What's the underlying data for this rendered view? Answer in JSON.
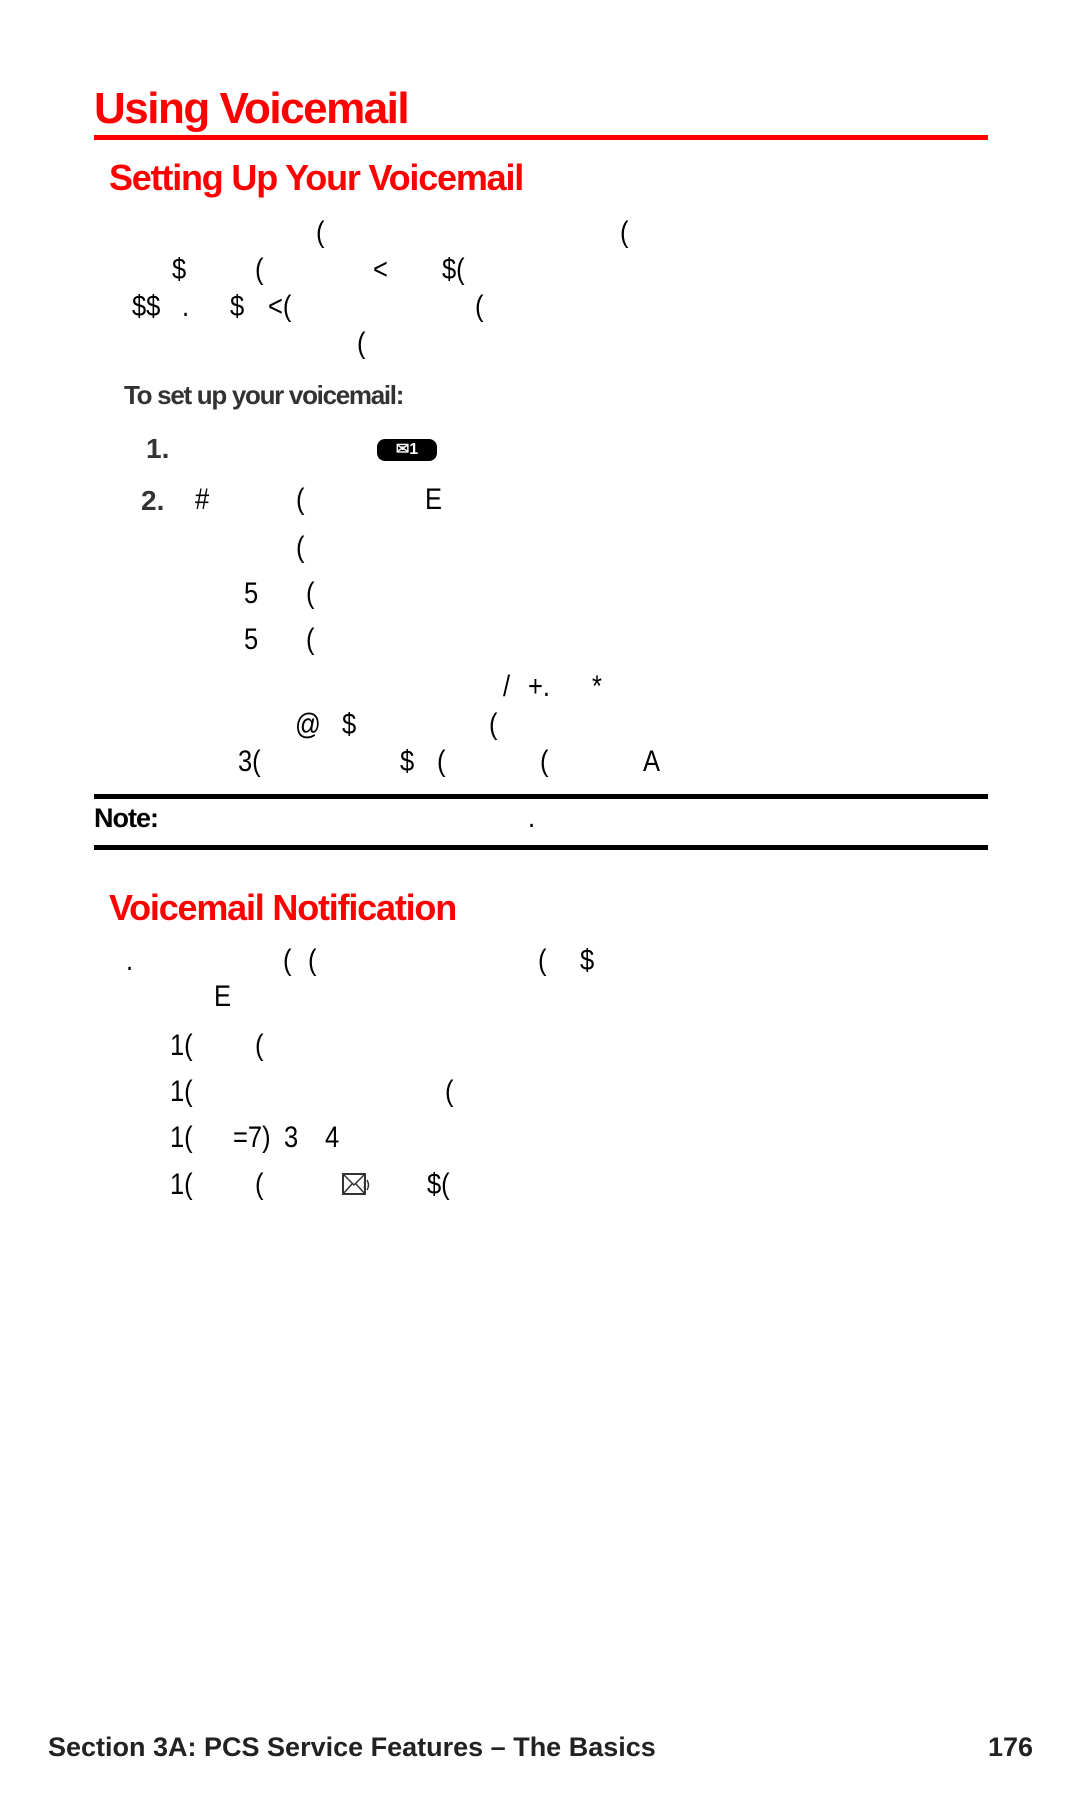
{
  "title": "Using Voicemail",
  "section1": {
    "heading": "Setting Up Your Voicemail",
    "p1": [
      "(",
      "("
    ],
    "p2": [
      "$",
      "(",
      "<",
      "$("
    ],
    "p3": [
      "$$",
      ".",
      "$",
      "<(",
      "("
    ],
    "p4": [
      "("
    ],
    "subheading": "To set up your voicemail:",
    "step1": {
      "num": "1.",
      "key_label": "1"
    },
    "step2": {
      "num": "2.",
      "frags": [
        "#",
        "(",
        "E"
      ]
    },
    "s3": [
      "("
    ],
    "s4": [
      "5",
      "("
    ],
    "s5": [
      "5",
      "("
    ],
    "s6": [
      "/",
      "+.",
      "*"
    ],
    "s7": [
      "@",
      "$",
      "("
    ],
    "s8": [
      "3(",
      "$",
      "(",
      "(",
      "A"
    ],
    "note": {
      "label": "Note:",
      "frags": [
        "."
      ]
    }
  },
  "section2": {
    "heading": "Voicemail Notification",
    "n1": [
      ".",
      "(",
      "(",
      "(",
      "$"
    ],
    "n2": [
      "E"
    ],
    "n3": [
      "1(",
      "("
    ],
    "n4": [
      "1(",
      "("
    ],
    "n5": [
      "1(",
      "=7)",
      "3",
      "4"
    ],
    "n6": [
      "1(",
      "(",
      "$("
    ]
  },
  "footer": {
    "section": "Section 3A: PCS Service Features – The Basics",
    "page": "176"
  },
  "colors": {
    "accent": "#ff0000"
  }
}
